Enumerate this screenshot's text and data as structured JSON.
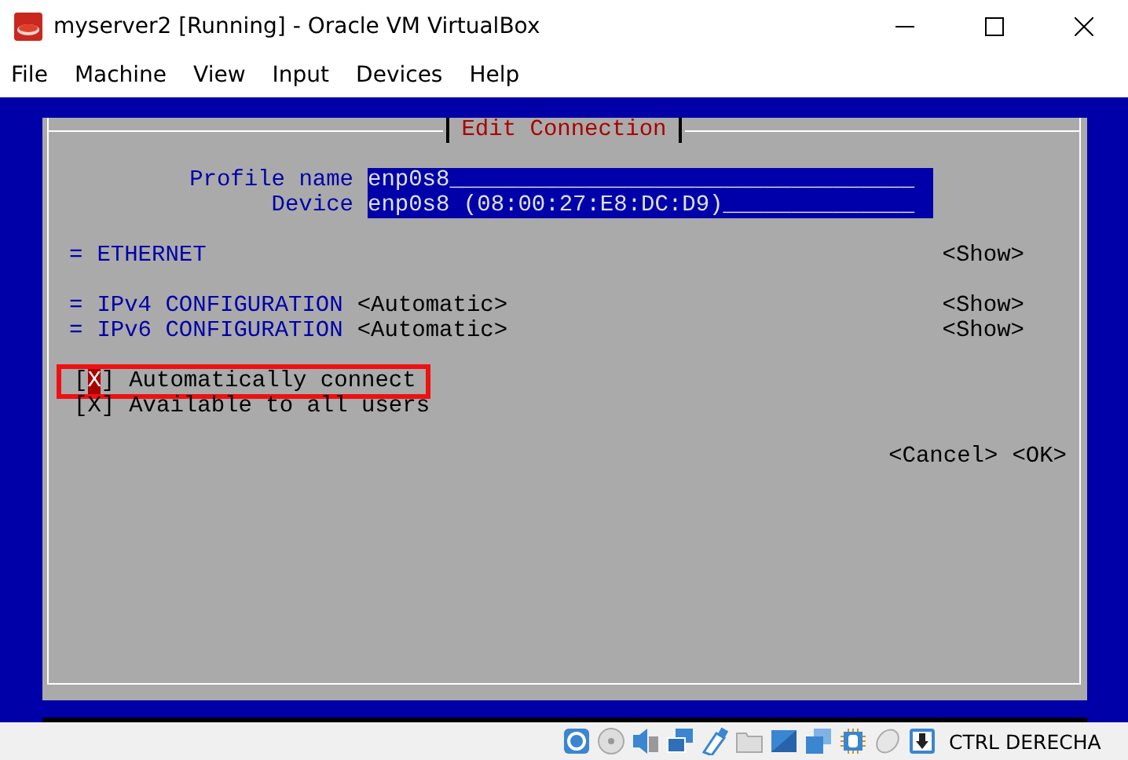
{
  "window": {
    "title": "myserver2 [Running] - Oracle VM VirtualBox"
  },
  "menu": [
    "File",
    "Machine",
    "View",
    "Input",
    "Devices",
    "Help"
  ],
  "dialog": {
    "title": "Edit Connection",
    "fields": [
      {
        "label": "Profile name",
        "value": "enp0s8__________________________________"
      },
      {
        "label": "Device",
        "value": "enp0s8 (08:00:27:E8:DC:D9)______________"
      }
    ],
    "section_groups": [
      {
        "sections": [
          {
            "marker": "=",
            "title": "ETHERNET",
            "action": "<Show>"
          }
        ]
      },
      {
        "sections": [
          {
            "marker": "=",
            "title": "IPv4 CONFIGURATION",
            "value": "<Automatic>",
            "action": "<Show>"
          },
          {
            "marker": "=",
            "title": "IPv6 CONFIGURATION",
            "value": "<Automatic>",
            "action": "<Show>"
          }
        ]
      }
    ],
    "checkboxes": [
      {
        "open": "[",
        "mark": "X",
        "close": "]",
        "label": "Automatically connect",
        "checked": true,
        "focused": true,
        "highlighted": true
      },
      {
        "open": "[",
        "mark": "X",
        "close": "]",
        "label": "Available to all users",
        "checked": true,
        "focused": false,
        "highlighted": false
      }
    ],
    "buttons": [
      "<Cancel>",
      "<OK>"
    ]
  },
  "status_bar": {
    "host_key": "CTRL DERECHA"
  }
}
